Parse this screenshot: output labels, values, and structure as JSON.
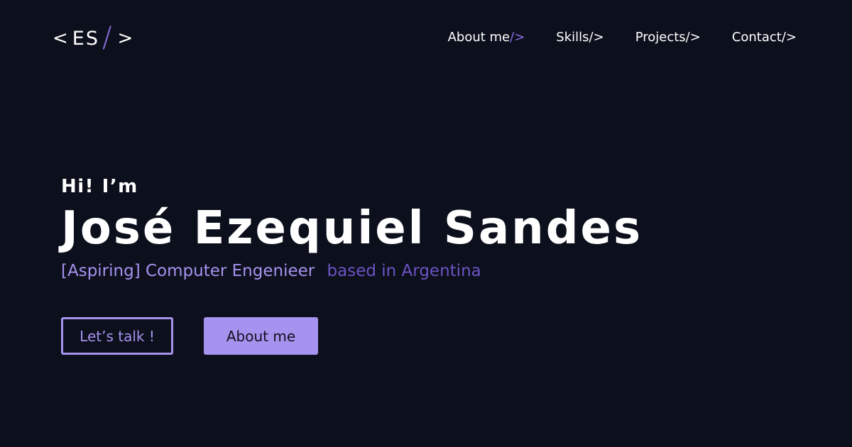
{
  "logo": {
    "open_bracket": "<",
    "initials": "ES",
    "slash": "/",
    "close_bracket": ">"
  },
  "nav": {
    "items": [
      {
        "label": "About me",
        "suffix": "/>",
        "suffix_color": "#8a6fe0"
      },
      {
        "label": "Skills",
        "suffix": "/>"
      },
      {
        "label": "Projects",
        "suffix": "/>"
      },
      {
        "label": "Contact",
        "suffix": "/>"
      }
    ]
  },
  "hero": {
    "greeting": "Hi! I’m",
    "name": "José Ezequiel Sandes",
    "role": "[Aspiring] Computer Engenieer",
    "location": "based in Argentina"
  },
  "buttons": {
    "talk_label": "Let’s talk !",
    "about_label": "About me"
  },
  "colors": {
    "background": "#0c0f1c",
    "accent": "#a593ef",
    "accent_dark": "#6b54c4",
    "text": "#ffffff"
  }
}
